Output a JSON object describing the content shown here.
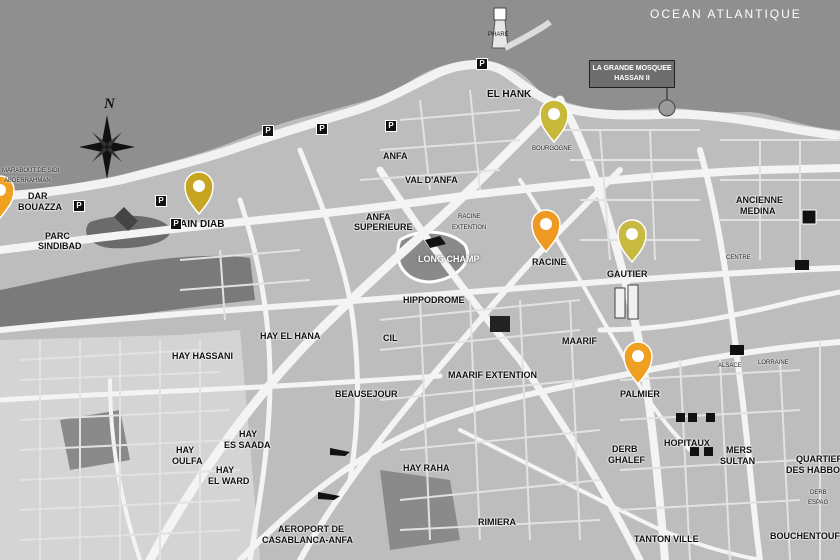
{
  "map": {
    "ocean_label": "OCEAN ATLANTIQUE",
    "compass_letter": "N",
    "landmark_box": {
      "line1": "LA GRANDE MOSQUEE",
      "line2": "HASSAN II"
    },
    "districts": [
      "EL HANK",
      "ANFA",
      "VAL D'ANFA",
      "ANFA",
      "SUPERIEURE",
      "AIN DIAB",
      "DAR",
      "BOUAZZA",
      "LONG CHAMP",
      "HIPPODROME",
      "RACINE",
      "EXTENTION",
      "RACINE",
      "BOURGOGNE",
      "GAUTIER",
      "MAARIF",
      "MAARIF EXTENTION",
      "PALMIER",
      "HAY EL HANA",
      "HAY HASSANI",
      "CIL",
      "BEAUSEJOUR",
      "HAY",
      "ES SAADA",
      "HAY",
      "OULFA",
      "HAY",
      "EL WARD",
      "HAY RAHA",
      "RIMIERA",
      "AEROPORT DE",
      "CASABLANCA-ANFA",
      "DERB",
      "GHALEF",
      "HOPITAUX",
      "MERS",
      "SULTAN",
      "ALSACE",
      "LORRAINE",
      "ANCIENNE",
      "MEDINA",
      "CENTRE",
      "QUARTIER",
      "DES HABBOUS",
      "TANTON VILLE",
      "BOUCHENTOUF",
      "ESPAG",
      "DERB",
      "MARABOUT DE SIDI",
      "ABDERRAHMAN",
      "PARC",
      "SINDIBAD",
      "PHARE"
    ],
    "pins": [
      {
        "name": "Dar Bouazza",
        "color": "#f0a020"
      },
      {
        "name": "Ain Diab",
        "color": "#c8a520"
      },
      {
        "name": "Bourgogne",
        "color": "#c9b93a"
      },
      {
        "name": "Racine",
        "color": "#ee9a22"
      },
      {
        "name": "Gautier",
        "color": "#c8b940"
      },
      {
        "name": "Palmier",
        "color": "#f0a020"
      }
    ],
    "parking_symbol": "P",
    "colors": {
      "sea": "#8f8f8f",
      "land": "#bdbdbd",
      "road": "#f2f2f2",
      "park": "#6b6b6b"
    }
  }
}
